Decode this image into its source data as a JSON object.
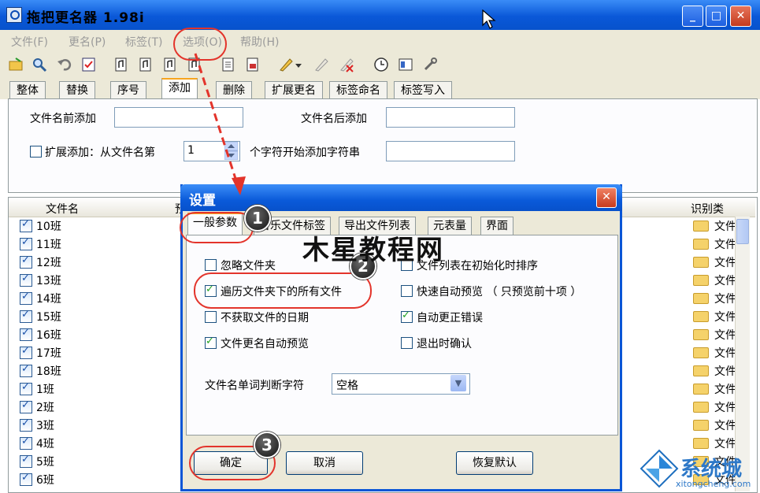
{
  "app": {
    "title": "拖把更名器 1.98i",
    "window_buttons": [
      "_",
      "□",
      "✕"
    ]
  },
  "menu": [
    "文件(F)",
    "更名(P)",
    "标签(T)",
    "选项(O)",
    "帮助(H)"
  ],
  "main_tabs": [
    "整体",
    "替换",
    "序号",
    "添加",
    "删除",
    "扩展更名",
    "标签命名",
    "标签写入"
  ],
  "add_panel": {
    "prefix_label": "文件名前添加",
    "suffix_label": "文件名后添加",
    "extend_label": "扩展添加：从文件名第",
    "position_value": "1",
    "after_label": "个字符开始添加字符串"
  },
  "list": {
    "header_filename": "文件名",
    "header_col2": "预",
    "header_type": "识别类",
    "rows": [
      "10班",
      "11班",
      "12班",
      "13班",
      "14班",
      "15班",
      "16班",
      "17班",
      "18班",
      "1班",
      "2班",
      "3班",
      "4班",
      "5班",
      "6班"
    ],
    "type_text": "文件"
  },
  "dialog": {
    "title": "设置",
    "close": "✕",
    "tabs": [
      "一般参数",
      "标签",
      "导出文件列表",
      "元表量",
      "界面"
    ],
    "tab2_prefix": "音乐文件",
    "options_left": [
      {
        "label": "忽略文件夹",
        "checked": false
      },
      {
        "label": "遍历文件夹下的所有文件",
        "checked": true
      },
      {
        "label": "不获取文件的日期",
        "checked": false
      },
      {
        "label": "文件更名自动预览",
        "checked": true
      }
    ],
    "options_right": [
      {
        "label": "文件列表在初始化时排序",
        "checked": false
      },
      {
        "label": "快速自动预览 （ 只预览前十项 ）",
        "checked": false
      },
      {
        "label": "自动更正错误",
        "checked": true
      },
      {
        "label": "退出时确认",
        "checked": false
      }
    ],
    "word_sep_label": "文件名单词判断字符",
    "word_sep_value": "空格",
    "ok": "确定",
    "cancel": "取消",
    "restore": "恢复默认"
  },
  "annotations": {
    "badges": [
      "1",
      "2",
      "3"
    ],
    "watermark": "木星教程网",
    "site_logo": "系统城",
    "site_url": "xitongcheng.com",
    "accent": "#e3342b"
  }
}
